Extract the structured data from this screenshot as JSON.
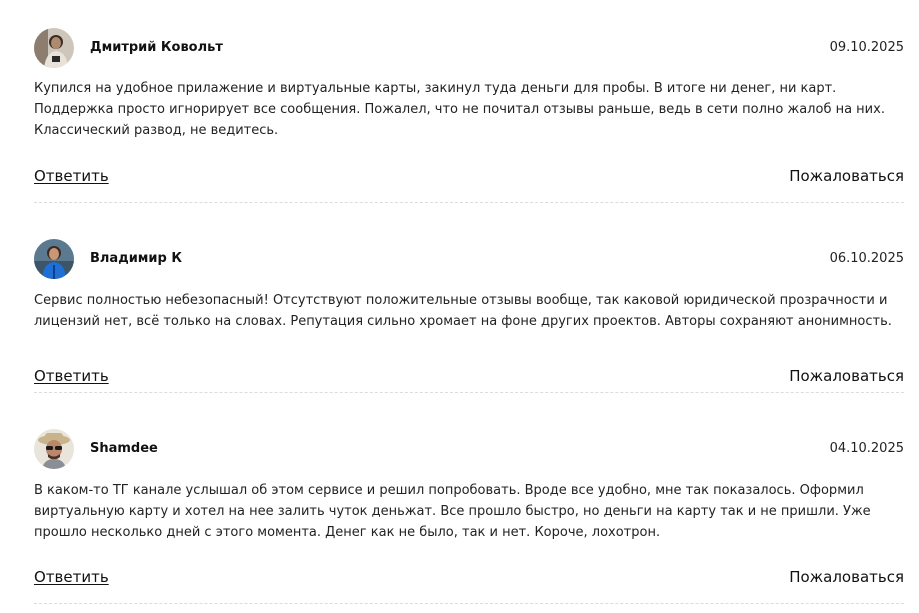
{
  "reviews": [
    {
      "author": "Дмитрий Ковольт",
      "date": "09.10.2025",
      "text": "Купился на удобное прилажение и виртуальные карты, закинул туда деньги для пробы. В итоге ни денег, ни карт. Поддержка просто игнорирует все сообщения. Пожалел, что не почитал отзывы раньше, ведь в сети полно жалоб на них. Классический развод, не ведитесь.",
      "reply_label": "Ответить",
      "report_label": "Пожаловаться",
      "avatar_icon": "user-photo-avatar"
    },
    {
      "author": "Владимир К",
      "date": "06.10.2025",
      "text": "Сервис полностью небезопасный! Отсутствуют положительные отзывы вообще, так каковой юридической прозрачности и лицензий нет, всё только на словах. Репутация сильно хромает на фоне других проектов. Авторы сохраняют анонимность.",
      "reply_label": "Ответить",
      "report_label": "Пожаловаться",
      "avatar_icon": "user-photo-avatar"
    },
    {
      "author": "Shamdee",
      "date": "04.10.2025",
      "text": "В каком-то ТГ канале услышал об этом сервисе и решил попробовать. Вроде все удобно, мне так показалось. Оформил виртуальную карту и хотел на нее залить чуток деньжат. Все прошло быстро, но деньги на карту так и не пришли. Уже прошло несколько дней с этого момента. Денег как не было, так и нет. Короче, лохотрон.",
      "reply_label": "Ответить",
      "report_label": "Пожаловаться",
      "avatar_icon": "user-photo-avatar"
    }
  ],
  "colors": {
    "text": "#222222",
    "divider": "#dcdcdc",
    "background": "#ffffff"
  }
}
